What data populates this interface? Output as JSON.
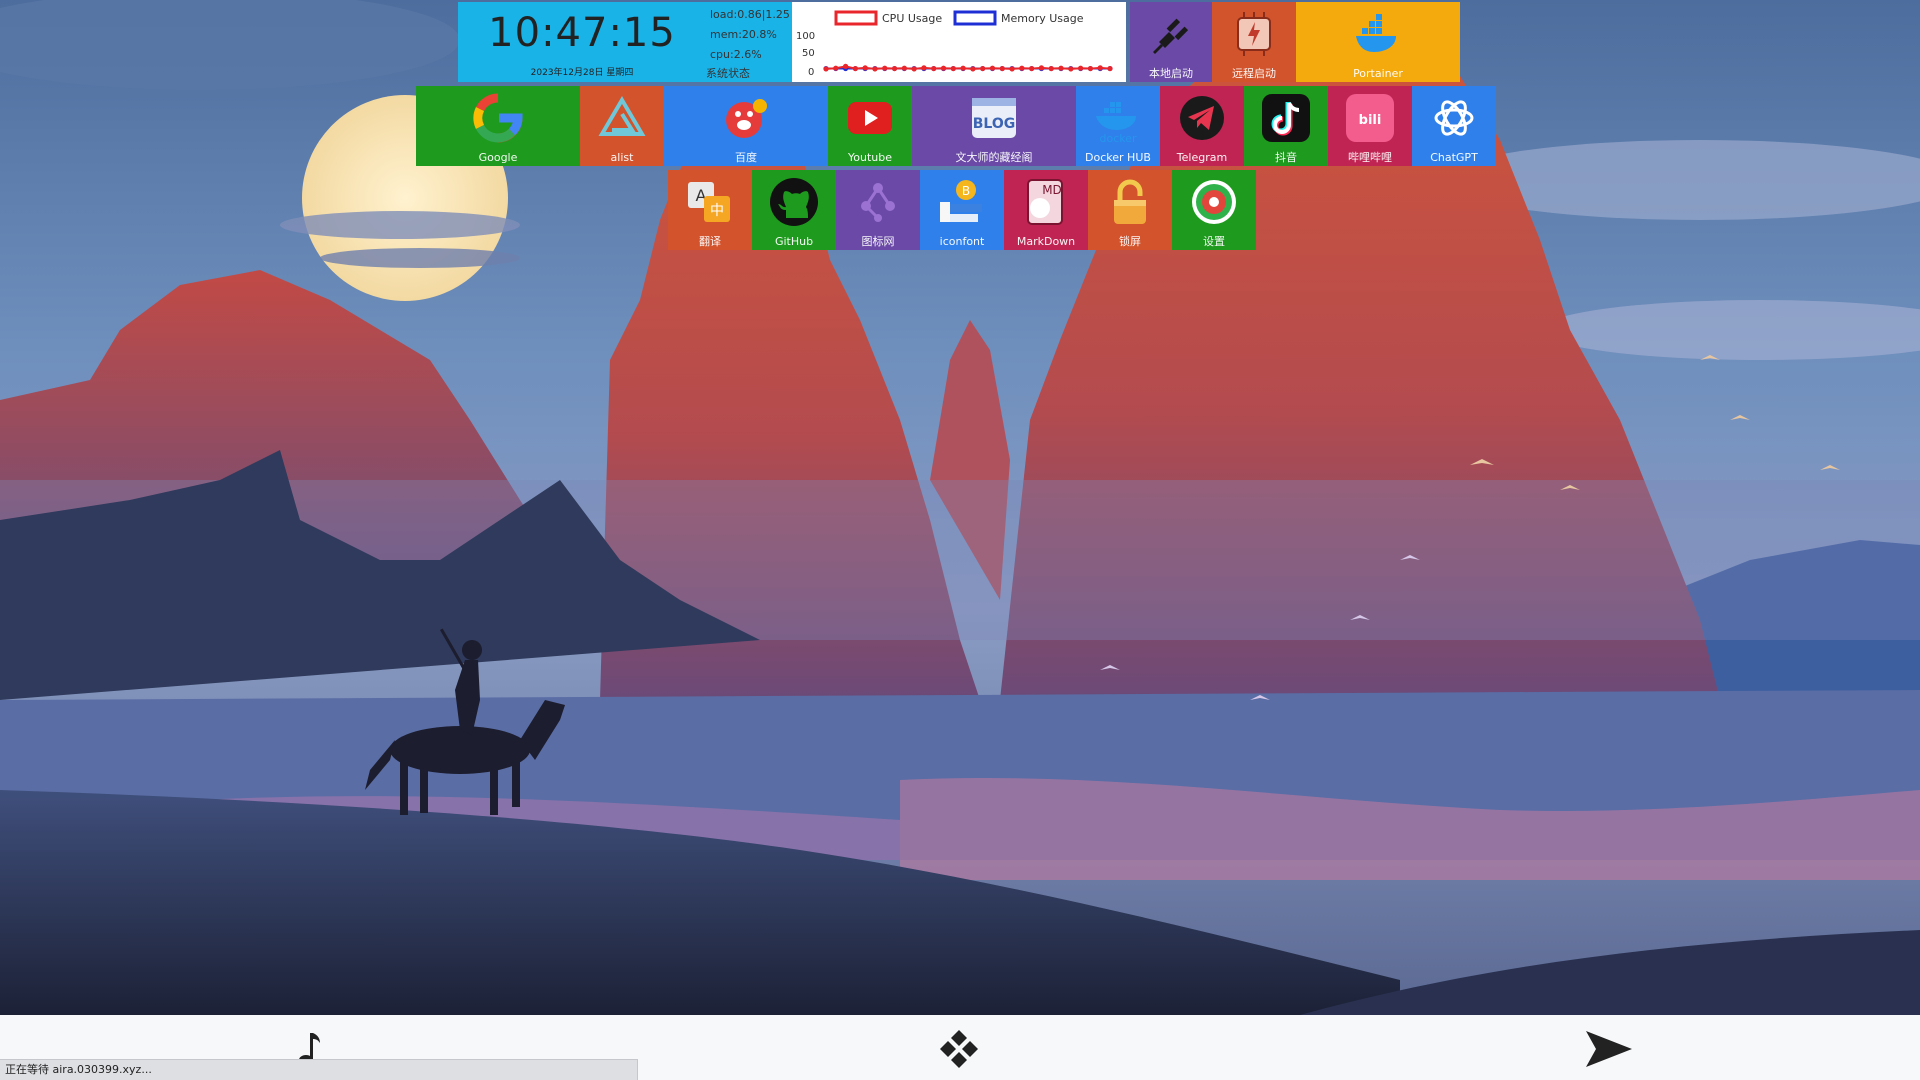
{
  "clock": {
    "time": "10:47:15",
    "date": "2023年12月28日  星期四"
  },
  "status": {
    "load": "load:0.86|1.25",
    "mem": "mem:20.8%",
    "cpu": "cpu:2.6%",
    "label": "系统状态"
  },
  "chart_data": {
    "type": "line",
    "title": "",
    "yticks": [
      "100",
      "50",
      "0"
    ],
    "ylim": [
      0,
      100
    ],
    "legend_placement": "top",
    "series": [
      {
        "name": "CPU Usage",
        "color": "#e8262b",
        "values": [
          3,
          5,
          10,
          4,
          6,
          3,
          5,
          4,
          5,
          3,
          6,
          4,
          5,
          4,
          5,
          3,
          4,
          5,
          4,
          3,
          5,
          4,
          6,
          4,
          5,
          3,
          5,
          4,
          6,
          4
        ]
      },
      {
        "name": "Memory Usage",
        "color": "#1f2fd6",
        "values": [
          4,
          4,
          4,
          4,
          4,
          4,
          4,
          4,
          4,
          4,
          4,
          4,
          4,
          4,
          4,
          4,
          4,
          4,
          4,
          4,
          4,
          4,
          4,
          4,
          4,
          4,
          4,
          4,
          4,
          4
        ]
      }
    ]
  },
  "tiles_row1_right": [
    {
      "label": "本地启动",
      "color": "#6a4aa6",
      "icon": "plug-icon"
    },
    {
      "label": "远程启动",
      "color": "#d1542c",
      "icon": "chip-icon"
    },
    {
      "label": "Portainer",
      "color": "#f4a90c",
      "icon": "docker-whale-icon"
    }
  ],
  "tiles_row2": [
    {
      "label": "Google",
      "color": "#1e9a1e",
      "icon": "google-icon"
    },
    {
      "label": "alist",
      "color": "#d2532c",
      "icon": "alist-icon"
    },
    {
      "label": "百度",
      "color": "#2f80ea",
      "icon": "baidu-icon"
    },
    {
      "label": "Youtube",
      "color": "#1e9a1e",
      "icon": "youtube-icon"
    },
    {
      "label": "文大师的藏经阁",
      "color": "#6a4aa6",
      "icon": "blog-icon"
    },
    {
      "label": "Docker HUB",
      "color": "#2f80ea",
      "icon": "docker-icon"
    },
    {
      "label": "Telegram",
      "color": "#c02452",
      "icon": "telegram-icon"
    },
    {
      "label": "抖音",
      "color": "#1e9a1e",
      "icon": "tiktok-icon"
    },
    {
      "label": "哔哩哔哩",
      "color": "#c02452",
      "icon": "bilibili-icon"
    },
    {
      "label": "ChatGPT",
      "color": "#2f80ea",
      "icon": "chatgpt-icon"
    }
  ],
  "tiles_row3": [
    {
      "label": "翻译",
      "color": "#d2532c",
      "icon": "translate-icon"
    },
    {
      "label": "GitHub",
      "color": "#1e9a1e",
      "icon": "github-icon"
    },
    {
      "label": "图标网",
      "color": "#6a4aa6",
      "icon": "iconsite-icon"
    },
    {
      "label": "iconfont",
      "color": "#2f80ea",
      "icon": "iconfont-icon"
    },
    {
      "label": "MarkDown",
      "color": "#c02452",
      "icon": "markdown-icon"
    },
    {
      "label": "锁屏",
      "color": "#d2532c",
      "icon": "lock-icon"
    },
    {
      "label": "设置",
      "color": "#1e9a1e",
      "icon": "settings-icon"
    }
  ],
  "dock": {
    "left_icon": "music-note-icon",
    "center_icon": "apps-diamond-icon",
    "right_icon": "send-arrow-icon"
  },
  "statusbar": {
    "text": "正在等待 aira.030399.xyz..."
  }
}
